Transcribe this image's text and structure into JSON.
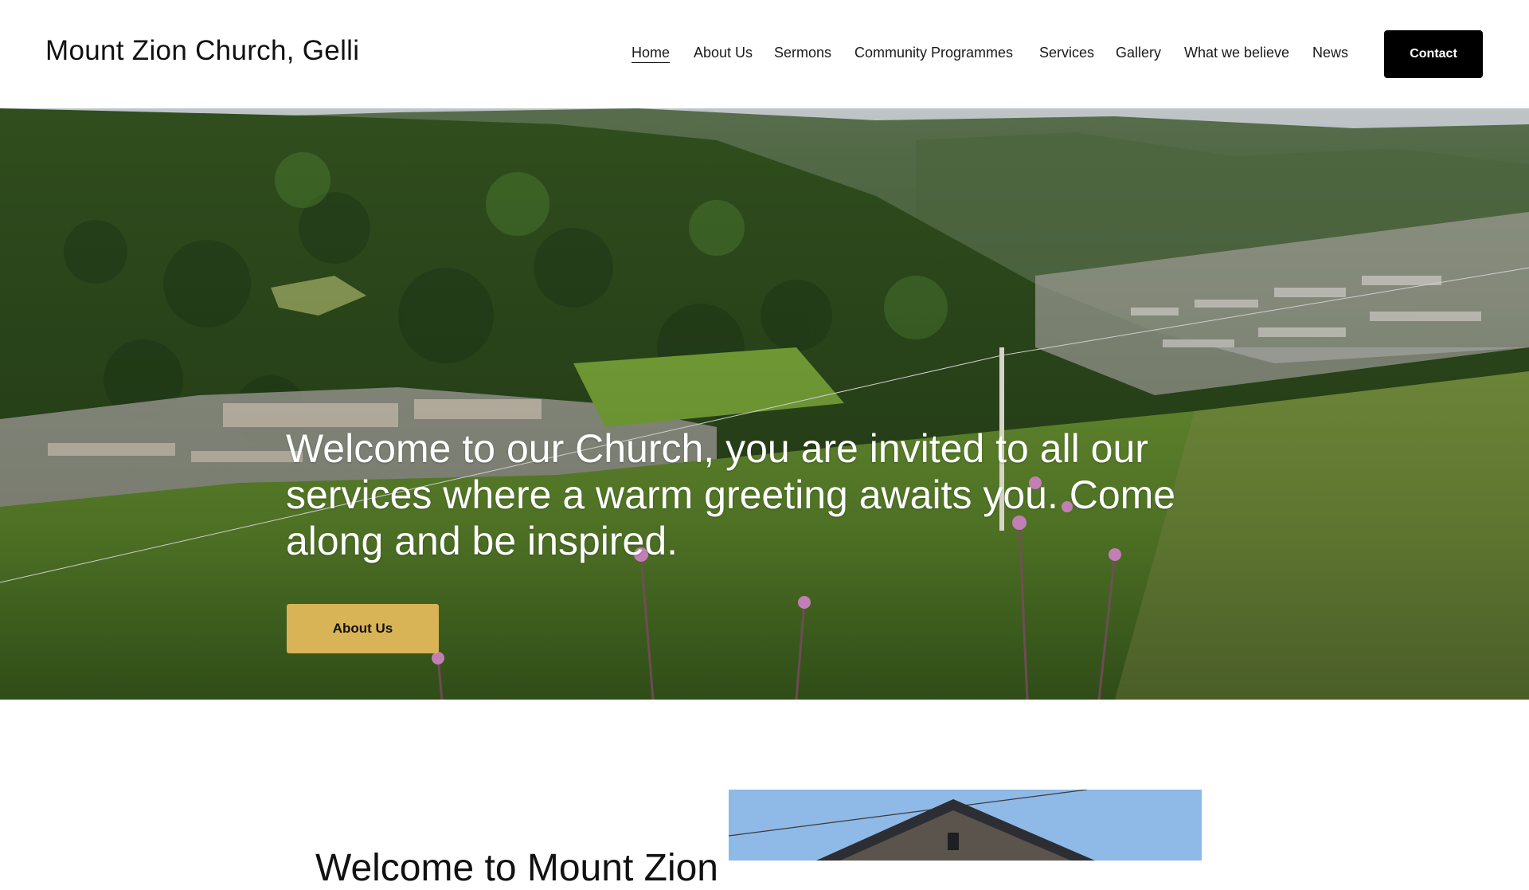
{
  "header": {
    "site_title": "Mount Zion Church, Gelli",
    "nav": [
      {
        "label": "Home",
        "active": true
      },
      {
        "label": "About Us"
      },
      {
        "label": "Sermons"
      },
      {
        "label": "Community Programmes"
      },
      {
        "label": "Services"
      },
      {
        "label": "Gallery"
      },
      {
        "label": "What we believe"
      },
      {
        "label": "News"
      }
    ],
    "contact_label": "Contact"
  },
  "hero": {
    "heading": "Welcome to our Church, you are invited to all our services where a warm greeting awaits you. Come along and be inspired.",
    "button_label": "About Us",
    "button_color": "#d9b456"
  },
  "intro": {
    "heading": "Welcome to Mount Zion"
  },
  "colors": {
    "contact_bg": "#000000",
    "sky": "#8fb9e6",
    "hill_green": "#3f6b2a"
  }
}
